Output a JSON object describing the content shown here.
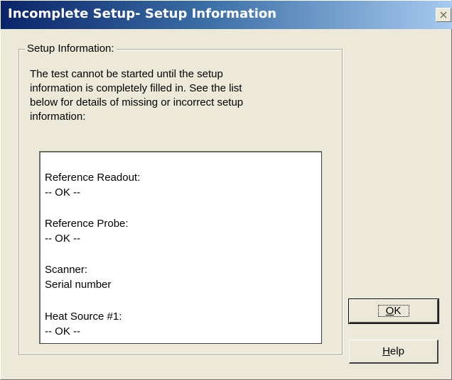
{
  "window": {
    "title": "Incomplete Setup- Setup Information"
  },
  "group": {
    "label": "Setup Information:",
    "message_lines": [
      "The test cannot be started until the setup",
      "information is completely filled in. See the list",
      "below for details of missing or incorrect setup",
      "information:"
    ]
  },
  "list": {
    "items": [
      {
        "heading": "Reference Readout:",
        "status": "-- OK --"
      },
      {
        "heading": "Reference Probe:",
        "status": "-- OK --"
      },
      {
        "heading": "Scanner:",
        "status": "Serial number"
      },
      {
        "heading": "Heat Source #1:",
        "status": "-- OK --"
      }
    ]
  },
  "buttons": {
    "ok": {
      "mnemonic": "O",
      "rest": "K"
    },
    "help": {
      "mnemonic": "H",
      "rest": "elp"
    }
  },
  "colors": {
    "titlebar_start": "#0A246A",
    "titlebar_end": "#A6CAF0",
    "face": "#ECE9D8"
  }
}
